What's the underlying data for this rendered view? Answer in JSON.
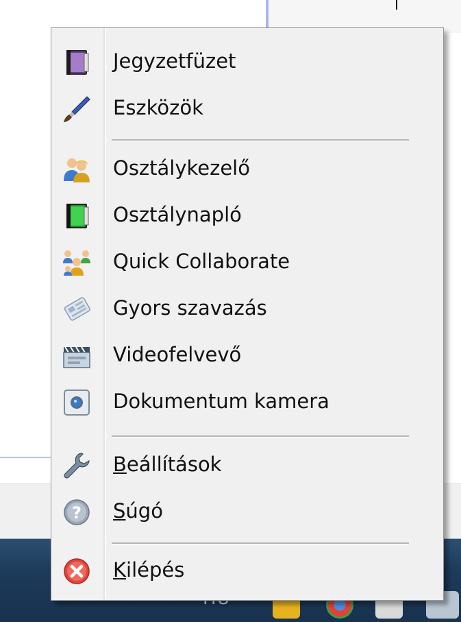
{
  "menu": {
    "items": [
      {
        "label": "Jegyzetfüzet",
        "icon": "notebook-icon"
      },
      {
        "label": "Eszközök",
        "icon": "paintbrush-icon"
      },
      {
        "label": "Osztálykezelő",
        "icon": "class-manager-icon"
      },
      {
        "label": "Osztálynapló",
        "icon": "class-log-icon"
      },
      {
        "label": "Quick Collaborate",
        "icon": "collaborate-icon"
      },
      {
        "label": "Gyors szavazás",
        "icon": "vote-icon"
      },
      {
        "label": "Videofelvevő",
        "icon": "video-recorder-icon"
      },
      {
        "label": "Dokumentum kamera",
        "icon": "document-camera-icon"
      },
      {
        "label_first": "B",
        "label_rest": "eállítások",
        "icon": "wrench-icon"
      },
      {
        "label_first": "S",
        "label_rest": "úgó",
        "icon": "help-icon"
      },
      {
        "label_first": "K",
        "label_rest": "ilépés",
        "icon": "exit-icon"
      }
    ]
  },
  "taskbar": {
    "text": "HU"
  },
  "colors": {
    "menu_bg": "#f0f0f0",
    "taskbar": "#1d3a5a",
    "exit_red": "#e2453c",
    "help_grey": "#8a98a8"
  }
}
